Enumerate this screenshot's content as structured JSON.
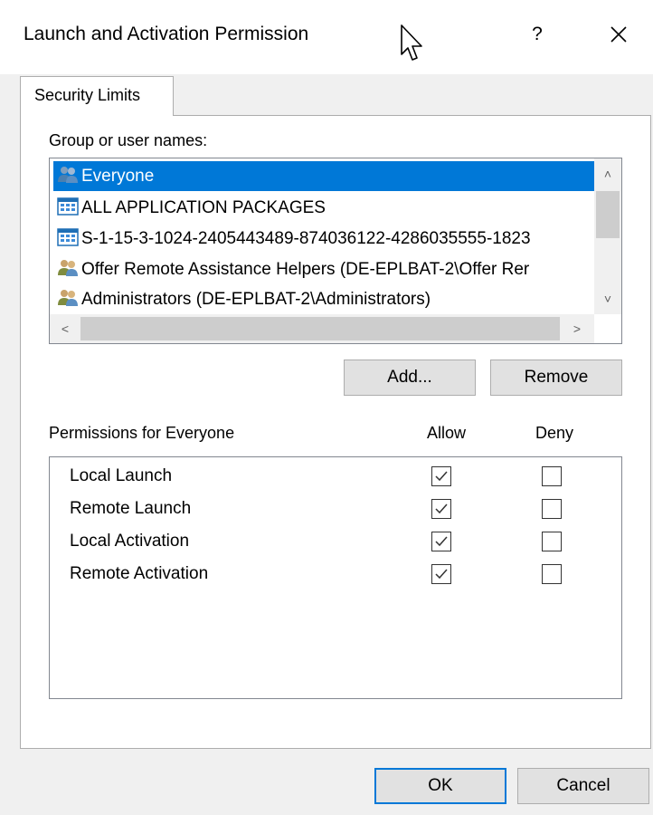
{
  "window": {
    "title": "Launch and Activation Permission",
    "help_label": "?"
  },
  "tabs": [
    {
      "label": "Security Limits",
      "selected": true
    }
  ],
  "group_users": {
    "label": "Group or user names:",
    "items": [
      {
        "name": "Everyone",
        "icon": "users-group-icon",
        "selected": true
      },
      {
        "name": "ALL APPLICATION PACKAGES",
        "icon": "app-packages-icon",
        "selected": false
      },
      {
        "name": "S-1-15-3-1024-2405443489-874036122-4286035555-1823",
        "icon": "sid-package-icon",
        "selected": false
      },
      {
        "name": "Offer Remote Assistance Helpers (DE-EPLBAT-2\\Offer Rer",
        "icon": "users-group-icon",
        "selected": false
      },
      {
        "name": "Administrators (DE-EPLBAT-2\\Administrators)",
        "icon": "users-group-icon",
        "selected": false
      }
    ]
  },
  "buttons": {
    "add": "Add...",
    "remove": "Remove",
    "ok": "OK",
    "cancel": "Cancel"
  },
  "permissions": {
    "title": "Permissions for Everyone",
    "allow_header": "Allow",
    "deny_header": "Deny",
    "rows": [
      {
        "name": "Local Launch",
        "allow": true,
        "deny": false
      },
      {
        "name": "Remote Launch",
        "allow": true,
        "deny": false
      },
      {
        "name": "Local Activation",
        "allow": true,
        "deny": false
      },
      {
        "name": "Remote Activation",
        "allow": true,
        "deny": false
      }
    ]
  },
  "colors": {
    "selection": "#0078d7",
    "dialog_bg": "#f0f0f0",
    "accent_default_button": "#0078d7"
  }
}
